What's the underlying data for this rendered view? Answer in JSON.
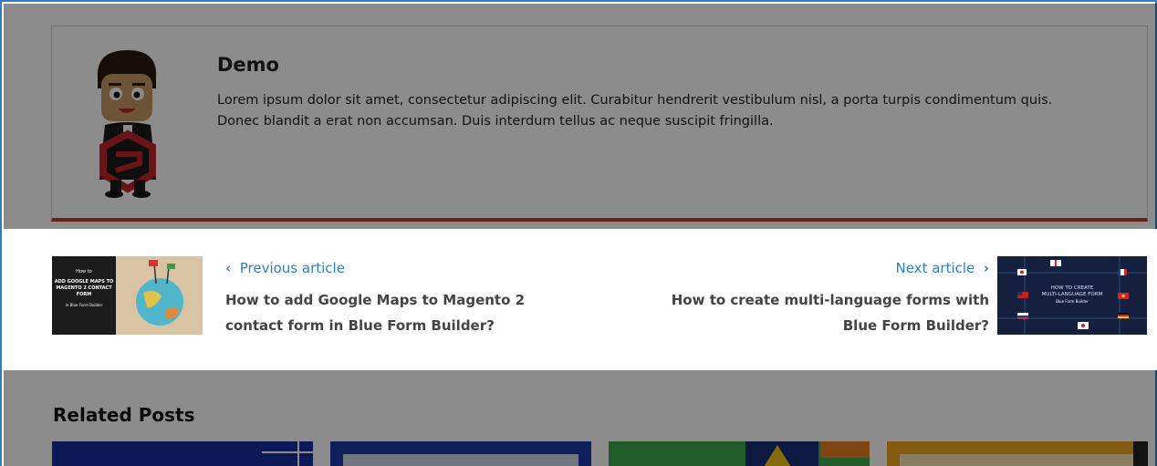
{
  "author": {
    "name": "Demo",
    "bio": "Lorem ipsum dolor sit amet, consectetur adipiscing elit. Curabitur hendrerit vestibulum nisl, a porta turpis condimentum quis. Donec blandit a erat non accumsan. Duis interdum tellus ac neque suscipit fringilla."
  },
  "post_nav": {
    "previous": {
      "label": "Previous article",
      "chevron": "‹",
      "title": "How to add Google Maps to Magento 2 contact form in Blue Form Builder?",
      "thumb_text_1": "How to",
      "thumb_text_2": "ADD GOOGLE MAPS TO MAGENTO 2 CONTACT FORM",
      "thumb_text_3": "in Blue Form Builder"
    },
    "next": {
      "label": "Next article",
      "chevron": "›",
      "title": "How to create multi-language forms with Blue Form Builder?",
      "thumb_text_1": "HOW TO CREATE",
      "thumb_text_2": "MULTI-LANGUAGE FORM",
      "thumb_text_3": "Blue Form Builder"
    }
  },
  "related": {
    "title": "Related Posts"
  },
  "colors": {
    "accent_red": "#c0392b",
    "link_blue": "#2f7fc0"
  }
}
